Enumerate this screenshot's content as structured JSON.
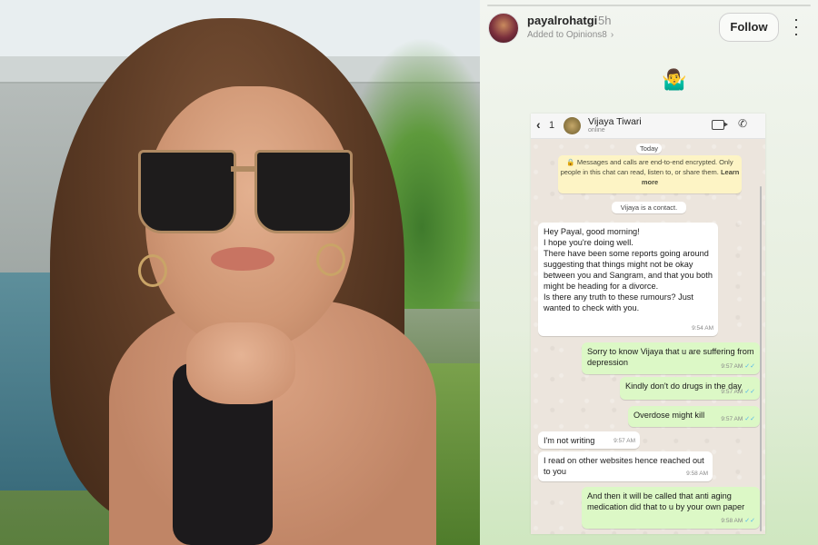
{
  "story": {
    "username": "payalrohatgi",
    "time_ago": "5h",
    "added_to": "Added to Opinions8",
    "follow_label": "Follow",
    "shrug_emoji": "🤷‍♂️"
  },
  "chat": {
    "back_count": "1",
    "contact_name": "Vijaya Tiwari",
    "contact_status": "online",
    "date_chip": "Today",
    "encryption_notice": "Messages and calls are end-to-end encrypted. Only people in this chat can read, listen to, or share them.",
    "learn_more": "Learn more",
    "contact_chip": "Vijaya is a contact.",
    "messages": [
      {
        "direction": "in",
        "text": "Hey Payal, good morning!\nI hope you're doing well.\nThere have been some reports going around suggesting that things might not be okay between you and Sangram, and that you both might be heading for a divorce.\nIs there any truth to these rumours? Just wanted to check with you.",
        "time": "9:54 AM"
      },
      {
        "direction": "out",
        "text": "Sorry to know Vijaya that u are suffering from depression",
        "time": "9:57 AM"
      },
      {
        "direction": "out",
        "text": "Kindly don't do drugs in the day",
        "time": "9:57 AM"
      },
      {
        "direction": "out",
        "text": "Overdose might kill",
        "time": "9:57 AM"
      },
      {
        "direction": "in",
        "text": "I'm not writing",
        "time": "9:57 AM"
      },
      {
        "direction": "in",
        "text": "I read on other websites hence reached out to you",
        "time": "9:58 AM"
      },
      {
        "direction": "out",
        "text": "And then it will be called that anti aging medication did that to u by your own paper",
        "time": "9:58 AM"
      }
    ]
  },
  "colors": {
    "incoming_bubble": "#ffffff",
    "outgoing_bubble": "#dcf8c6",
    "chat_background": "#ece5dd",
    "read_ticks": "#4fb6ec"
  }
}
